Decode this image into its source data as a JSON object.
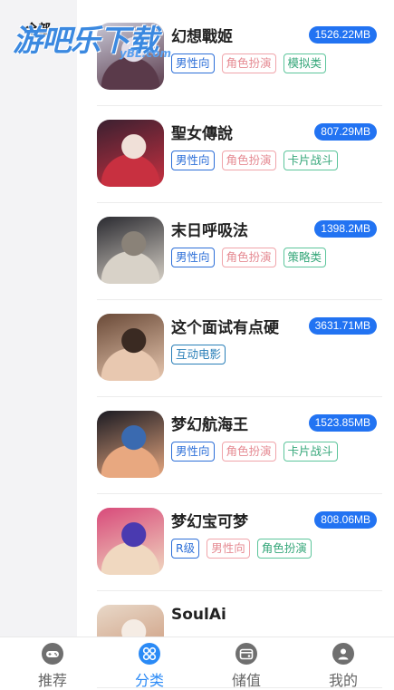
{
  "watermark": {
    "text": "游吧乐下载",
    "sub": "yBL.com"
  },
  "sidebar": {
    "selected_label": "全部"
  },
  "games": [
    {
      "name": "幻想戰姬",
      "size": "1526.22MB",
      "tags": [
        [
          "男性向",
          "blue"
        ],
        [
          "角色扮演",
          "pink"
        ],
        [
          "模拟类",
          "green"
        ]
      ],
      "colors": [
        "#c7c7d6",
        "#5a3a4a",
        "#e2dde8"
      ]
    },
    {
      "name": "聖女傳說",
      "size": "807.29MB",
      "tags": [
        [
          "男性向",
          "blue"
        ],
        [
          "角色扮演",
          "pink"
        ],
        [
          "卡片战斗",
          "green"
        ]
      ],
      "colors": [
        "#3a2030",
        "#c83040",
        "#f0e0d8"
      ]
    },
    {
      "name": "末日呼吸法",
      "size": "1398.2MB",
      "tags": [
        [
          "男性向",
          "blue"
        ],
        [
          "角色扮演",
          "pink"
        ],
        [
          "策略类",
          "green"
        ]
      ],
      "colors": [
        "#2a2a30",
        "#d8d2c8",
        "#8a8278"
      ]
    },
    {
      "name": "这个面试有点硬",
      "size": "3631.71MB",
      "tags": [
        [
          "互动电影",
          "teal"
        ]
      ],
      "colors": [
        "#6a4a38",
        "#e8c8b0",
        "#3a2a22"
      ]
    },
    {
      "name": "梦幻航海王",
      "size": "1523.85MB",
      "tags": [
        [
          "男性向",
          "blue"
        ],
        [
          "角色扮演",
          "pink"
        ],
        [
          "卡片战斗",
          "green"
        ]
      ],
      "colors": [
        "#1a1a22",
        "#e8a880",
        "#3a6ab0"
      ]
    },
    {
      "name": "梦幻宝可梦",
      "size": "808.06MB",
      "tags": [
        [
          "R级",
          "blue"
        ],
        [
          "男性向",
          "pink"
        ],
        [
          "角色扮演",
          "green"
        ]
      ],
      "colors": [
        "#d84a7a",
        "#f0d8c0",
        "#4a3ab0"
      ]
    },
    {
      "name": "SoulAi",
      "size": "",
      "tags": [],
      "colors": [
        "#e8d8c8",
        "#c89070",
        "#f5ece4"
      ]
    }
  ],
  "tabbar": [
    {
      "label": "推荐",
      "icon": "gamepad-icon",
      "active": false
    },
    {
      "label": "分类",
      "icon": "category-icon",
      "active": true
    },
    {
      "label": "储值",
      "icon": "wallet-icon",
      "active": false
    },
    {
      "label": "我的",
      "icon": "user-icon",
      "active": false
    }
  ]
}
